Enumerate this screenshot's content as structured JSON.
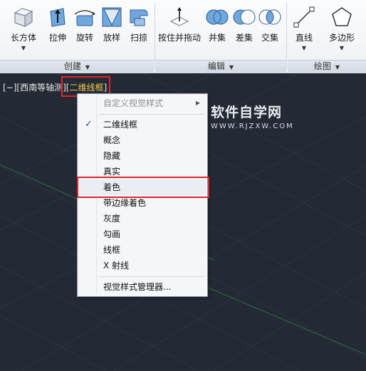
{
  "ribbon": {
    "tools": [
      {
        "label": "长方体",
        "icon": "box-icon",
        "has_dropdown": true
      },
      {
        "label": "拉伸",
        "icon": "extrude-icon",
        "has_dropdown": false
      },
      {
        "label": "旋转",
        "icon": "revolve-icon",
        "has_dropdown": false
      },
      {
        "label": "放样",
        "icon": "loft-icon",
        "has_dropdown": false
      },
      {
        "label": "扫掠",
        "icon": "sweep-icon",
        "has_dropdown": false
      },
      {
        "label": "按住并拖动",
        "icon": "presspull-icon",
        "has_dropdown": false
      },
      {
        "label": "并集",
        "icon": "union-icon",
        "has_dropdown": false
      },
      {
        "label": "差集",
        "icon": "subtract-icon",
        "has_dropdown": false
      },
      {
        "label": "交集",
        "icon": "intersect-icon",
        "has_dropdown": false
      },
      {
        "label": "直线",
        "icon": "line-icon",
        "has_dropdown": true
      },
      {
        "label": "多边形",
        "icon": "polygon-icon",
        "has_dropdown": true
      }
    ],
    "panels": [
      {
        "label": "创建"
      },
      {
        "label": "编辑"
      },
      {
        "label": "绘图"
      }
    ]
  },
  "viewport": {
    "label_prefix": "[−][西南等轴测][",
    "label_active": "二维线框",
    "label_suffix": "]",
    "watermark_title": "软件自学网",
    "watermark_url": "WWW.RJZXW.COM"
  },
  "menu": {
    "items": [
      {
        "label": "自定义视觉样式",
        "disabled": true,
        "submenu": true
      },
      {
        "label": "二维线框",
        "checked": true
      },
      {
        "label": "概念"
      },
      {
        "label": "隐藏"
      },
      {
        "label": "真实"
      },
      {
        "label": "着色",
        "highlighted": true
      },
      {
        "label": "带边缘着色"
      },
      {
        "label": "灰度"
      },
      {
        "label": "勾画"
      },
      {
        "label": "线框"
      },
      {
        "label": "X 射线"
      },
      {
        "label": "视觉样式管理器..."
      }
    ],
    "checkmark": "✓",
    "submenu_arrow": "▶"
  },
  "colors": {
    "viewport_bg": "#232a35",
    "active_label": "#f2c94c",
    "annotation_red": "#e0252b"
  }
}
